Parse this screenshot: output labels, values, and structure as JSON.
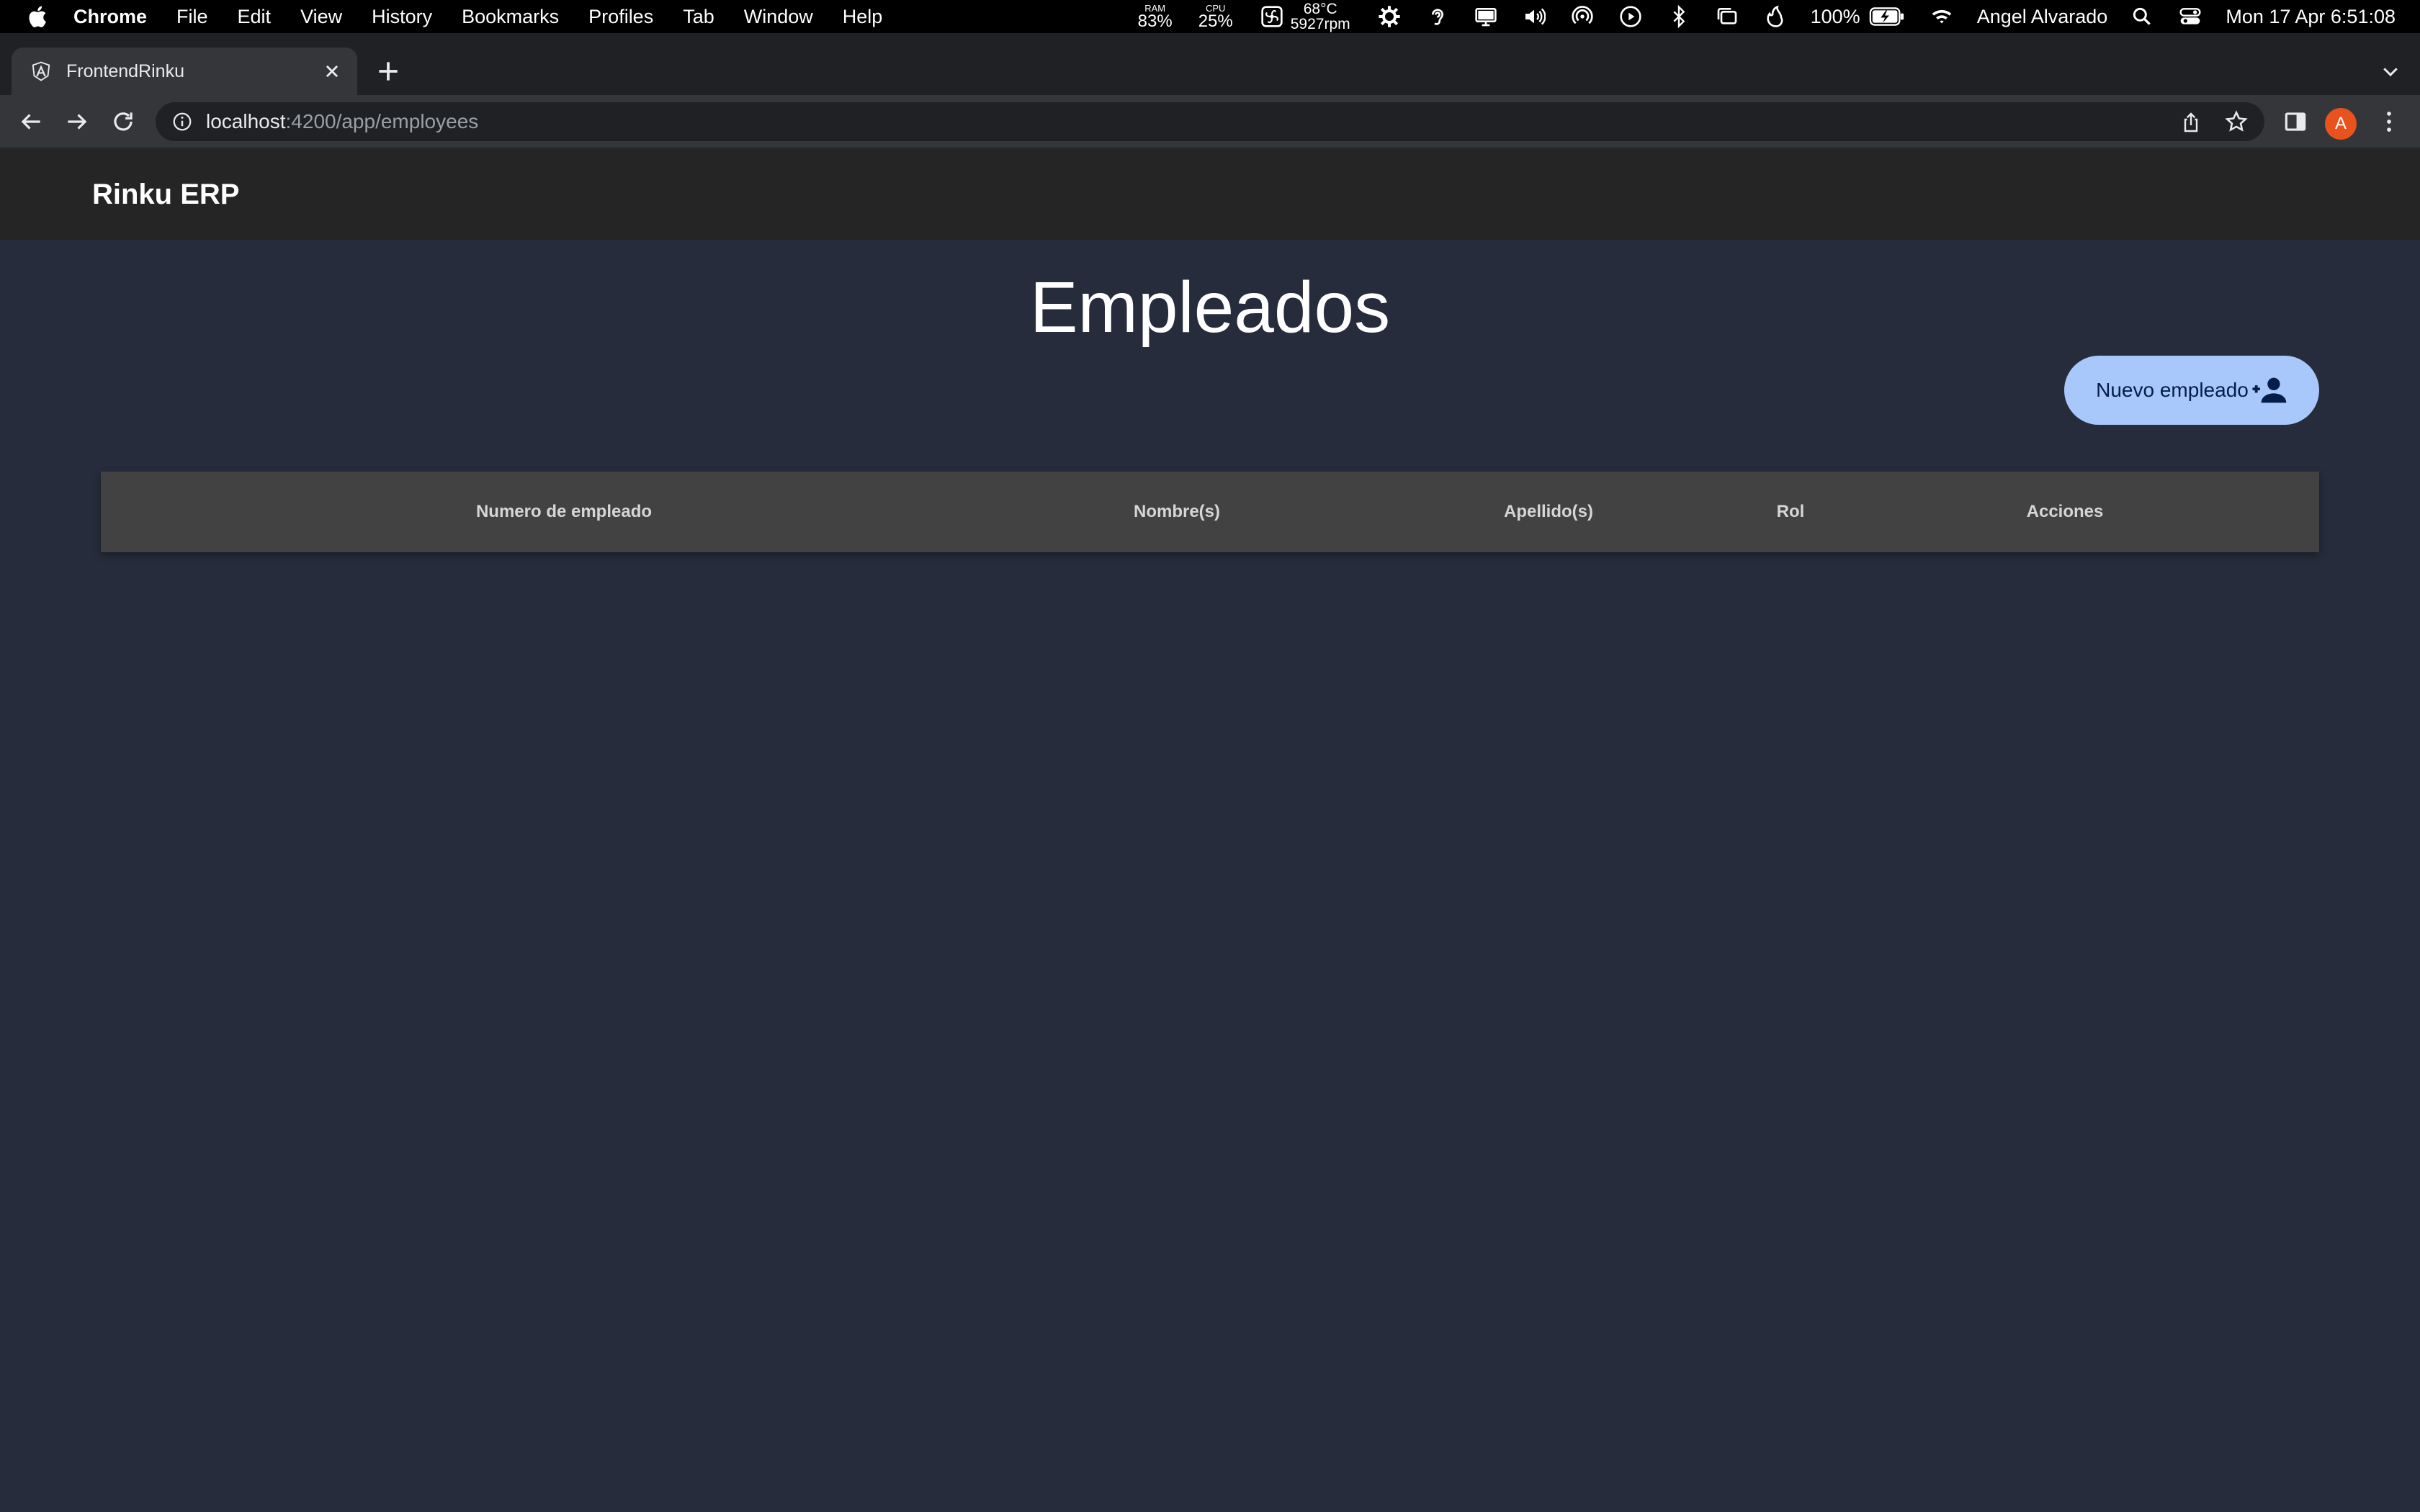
{
  "menubar": {
    "app_name": "Chrome",
    "items": [
      "File",
      "Edit",
      "View",
      "History",
      "Bookmarks",
      "Profiles",
      "Tab",
      "Window",
      "Help"
    ],
    "ram_label": "RAM",
    "ram_value": "83%",
    "cpu_label": "CPU",
    "cpu_value": "25%",
    "temp": "68°C",
    "fan": "5927rpm",
    "battery": "100%",
    "user": "Angel Alvarado",
    "datetime": "Mon 17 Apr  6:51:08"
  },
  "browser": {
    "tab_title": "FrontendRinku",
    "url_host": "localhost",
    "url_path": ":4200/app/employees",
    "profile_initial": "A"
  },
  "app": {
    "brand": "Rinku ERP",
    "page_title": "Empleados",
    "new_button_label": "Nuevo empleado",
    "table": {
      "columns": [
        "Numero de empleado",
        "Nombre(s)",
        "Apellido(s)",
        "Rol",
        "Acciones"
      ],
      "rows": []
    }
  },
  "colors": {
    "page_background": "#262c3b",
    "header_background": "#252526",
    "table_header_background": "#424242",
    "primary_button": "#a8c7fa",
    "profile_avatar": "#e8531d"
  }
}
